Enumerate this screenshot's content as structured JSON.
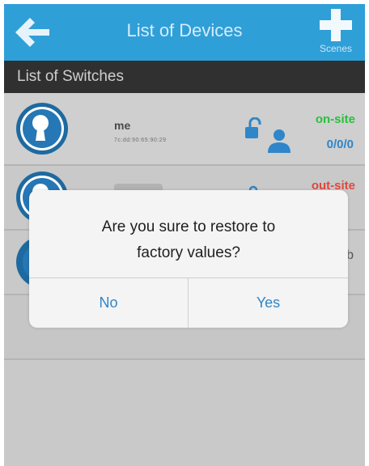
{
  "header": {
    "title": "List of Devices",
    "scenes_label": "Scenes",
    "back_icon": "arrow-left-icon",
    "add_icon": "plus-icon",
    "color": "#2f9fd8"
  },
  "section": {
    "title": "List of Switches"
  },
  "devices": [
    {
      "name": "me",
      "mac": "7c:dd:90:65:90:29",
      "status": "on-site",
      "count": "0/0/0"
    },
    {
      "status": "out-site"
    },
    {
      "trailing": "b"
    }
  ],
  "dialog": {
    "message_line1": "Are you sure to restore to",
    "message_line2": "factory values?",
    "no_label": "No",
    "yes_label": "Yes"
  },
  "colors": {
    "on_site": "#27c03c",
    "out_site": "#e0473d",
    "accent": "#2f86c9"
  }
}
